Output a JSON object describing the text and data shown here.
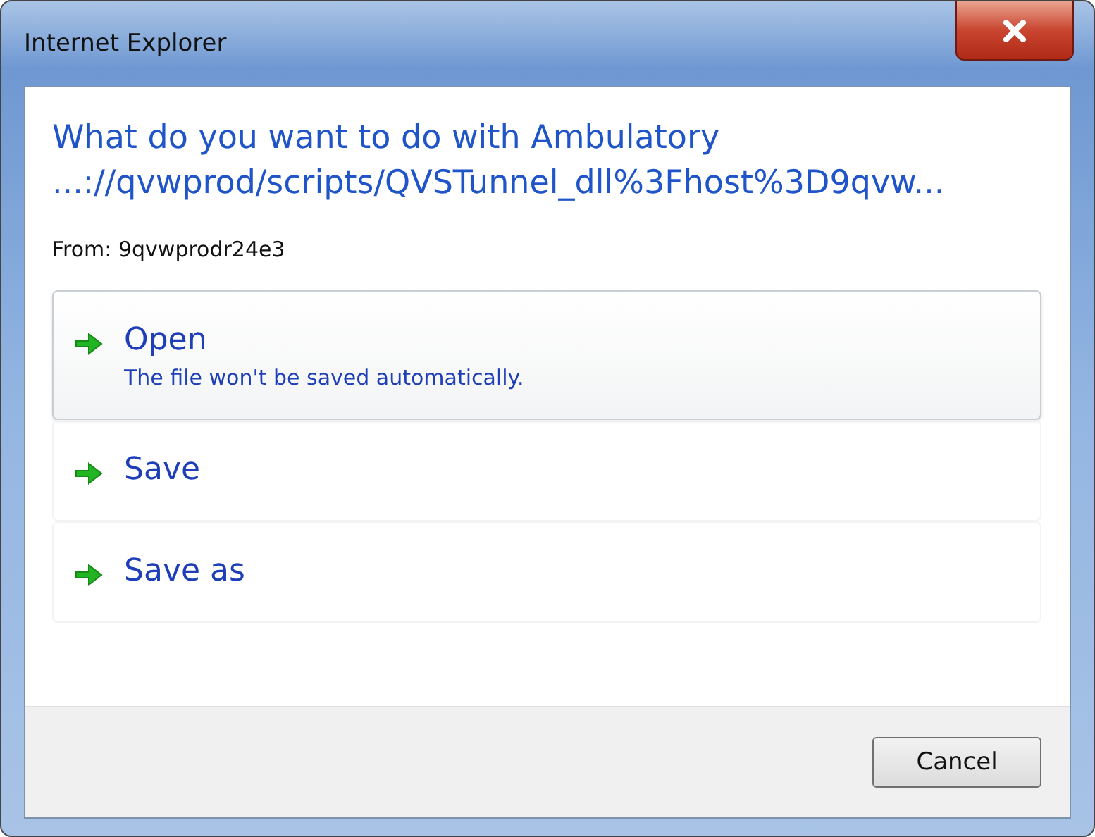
{
  "window": {
    "title": "Internet Explorer"
  },
  "heading": [
    "What do you want to do with Ambulatory",
    "...://qvwprod/scripts/QVSTunnel_dll%3Fhost%3D9qvw..."
  ],
  "from": "From: 9qvwprodr24e3",
  "options": [
    {
      "label": "Open",
      "description": "The file won't be saved automatically.",
      "selected": true
    },
    {
      "label": "Save",
      "selected": false
    },
    {
      "label": "Save as",
      "selected": false
    }
  ],
  "buttons": [
    "Cancel"
  ]
}
